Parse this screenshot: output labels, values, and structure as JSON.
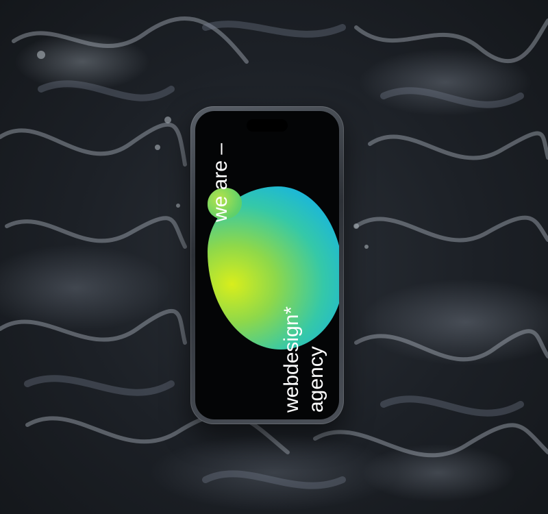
{
  "photo": {
    "subject": "phone-in-water",
    "colors": {
      "water": "#1c2026",
      "blob_yellow": "#d8ee1c",
      "blob_cyan": "#1cb7d8",
      "screen": "#040506"
    }
  },
  "phone_screen": {
    "line1": "we are –",
    "line2": "webdesign*",
    "line3": "agency"
  }
}
